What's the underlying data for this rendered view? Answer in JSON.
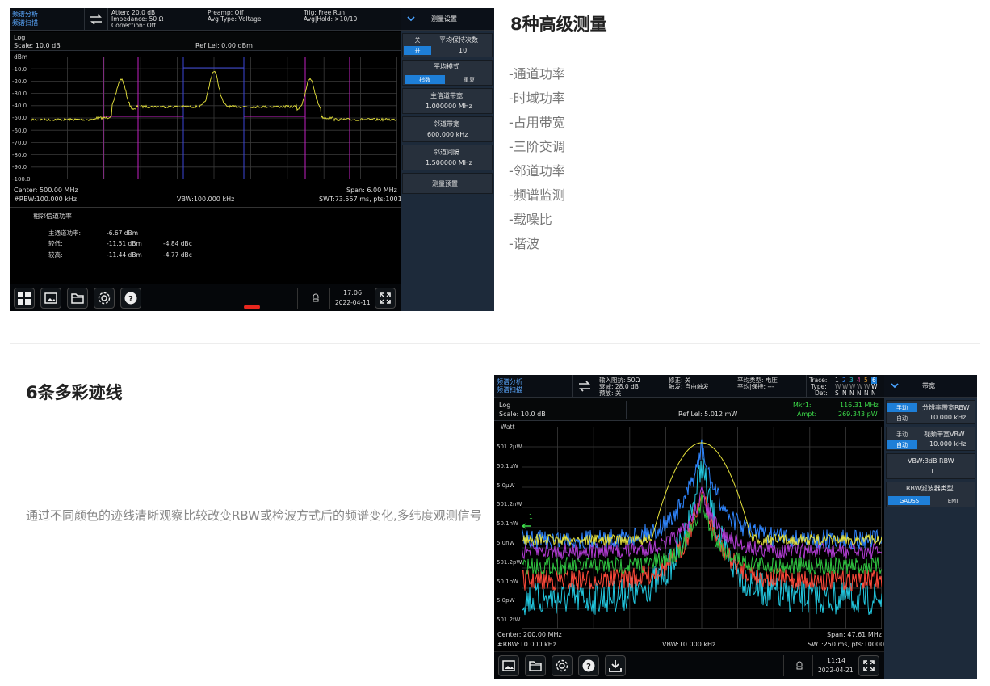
{
  "panel1": {
    "mode_line1": "频谱分析",
    "mode_line2": "频谱扫描",
    "atten": "Atten: 20.0 dB",
    "impedance": "Impedance: 50 Ω",
    "correction": "Correction: Off",
    "preamp": "Preamp: Off",
    "avg_type": "Avg Type: Voltage",
    "trig": "Trig: Free Run",
    "avg_hold": "Avg|Hold: >10/10",
    "log": "Log",
    "scale": "Scale: 10.0 dB",
    "ref_level": "Ref Lel: 0.00 dBm",
    "unit": "dBm",
    "y_ticks": [
      "-10.0",
      "-20.0",
      "-30.0",
      "-40.0",
      "-50.0",
      "-60.0",
      "-70.0",
      "-80.0",
      "-90.0",
      "-100.0"
    ],
    "center": "Center: 500.00 MHz",
    "span": "Span: 6.00 MHz",
    "rbw": "#RBW:100.000 kHz",
    "vbw": "VBW:100.000 kHz",
    "swt": "SWT:73.557 ms, pts:1001",
    "result_title": "相邻信道功率",
    "results": [
      {
        "label": "主通道功率:",
        "value": "-6.67 dBm",
        "rel": ""
      },
      {
        "label": "较低:",
        "value": "-11.51 dBm",
        "rel": "-4.84 dBc"
      },
      {
        "label": "较高:",
        "value": "-11.44 dBm",
        "rel": "-4.77 dBc"
      }
    ],
    "time": "17:06",
    "date": "2022-04-11",
    "side": {
      "title": "测量设置",
      "off": "关",
      "on": "开",
      "avg_count_label": "平均保持次数",
      "avg_count_value": "10",
      "avg_mode_label": "平均模式",
      "avg_mode_exp": "指数",
      "avg_mode_rep": "重复",
      "main_bw_label": "主信道带宽",
      "main_bw_value": "1.000000 MHz",
      "adj_bw_label": "邻道带宽",
      "adj_bw_value": "600.000 kHz",
      "adj_sp_label": "邻道间隔",
      "adj_sp_value": "1.500000 MHz",
      "preset": "测量预置"
    }
  },
  "section1": {
    "title": "8种高级测量",
    "features": [
      "-通道功率",
      "-时域功率",
      "-占用带宽",
      "-三阶交调",
      "-邻道功率",
      "-频谱监测",
      "-载噪比",
      "-谐波"
    ]
  },
  "section2": {
    "title": "6条多彩迹线",
    "desc": "通过不同颜色的迹线清晰观察比较改变RBW或检波方式后的频谱变化,多纬度观测信号"
  },
  "panel2": {
    "mode_line1": "频谱分析",
    "mode_line2": "频谱扫描",
    "impedance": "输入阻抗: 50Ω",
    "atten": "衰减: 28.0 dB",
    "preamp": "预放: 关",
    "correction": "修正: 关",
    "trigger": "触发: 自由触发",
    "avg_type": "平均类型: 电压",
    "avg_hold": "平均|保持: ---",
    "trace_label": "Trace:",
    "type_label": "Type:",
    "det_label": "Det:",
    "trace_nums": [
      "1",
      "2",
      "3",
      "4",
      "5",
      "6"
    ],
    "trace_types": [
      "W",
      "W",
      "W",
      "W",
      "W",
      "W"
    ],
    "trace_dets": [
      "S",
      "N",
      "N",
      "N",
      "N",
      "N"
    ],
    "log": "Log",
    "scale": "Scale: 10.0 dB",
    "ref_level": "Ref Lel: 5.012 mW",
    "mkr_label": "Mkr1:",
    "mkr_freq": "116.31 MHz",
    "ampt_label": "Ampt:",
    "mkr_ampt": "269.343 pW",
    "unit": "Watt",
    "y_ticks": [
      "501.2μW",
      "50.1μW",
      "5.0μW",
      "501.2nW",
      "50.1nW",
      "5.0nW",
      "501.2pW",
      "50.1pW",
      "5.0pW",
      "501.2fW"
    ],
    "marker_num": "1",
    "center": "Center: 200.00 MHz",
    "span": "Span: 47.61 MHz",
    "rbw": "#RBW:10.000 kHz",
    "vbw": "VBW:10.000 kHz",
    "swt": "SWT:250 ms, pts:10000",
    "time": "11:14",
    "date": "2022-04-21",
    "side": {
      "title": "带宽",
      "manual": "手动",
      "auto": "自动",
      "rbw_label": "分辨率带宽RBW",
      "rbw_value": "10.000 kHz",
      "vbw_label": "视频带宽VBW",
      "vbw_value": "10.000 kHz",
      "ratio_label": "VBW:3dB RBW",
      "ratio_value": "1",
      "filter_label": "RBW滤波器类型",
      "gauss": "GAUSS",
      "emi": "EMI"
    }
  },
  "colors": {
    "trace_yellow": "#e7e33c",
    "accent_blue": "#1e7fd8",
    "marker_green": "#3ddc4a",
    "channel_magenta": "#c21fc2"
  }
}
